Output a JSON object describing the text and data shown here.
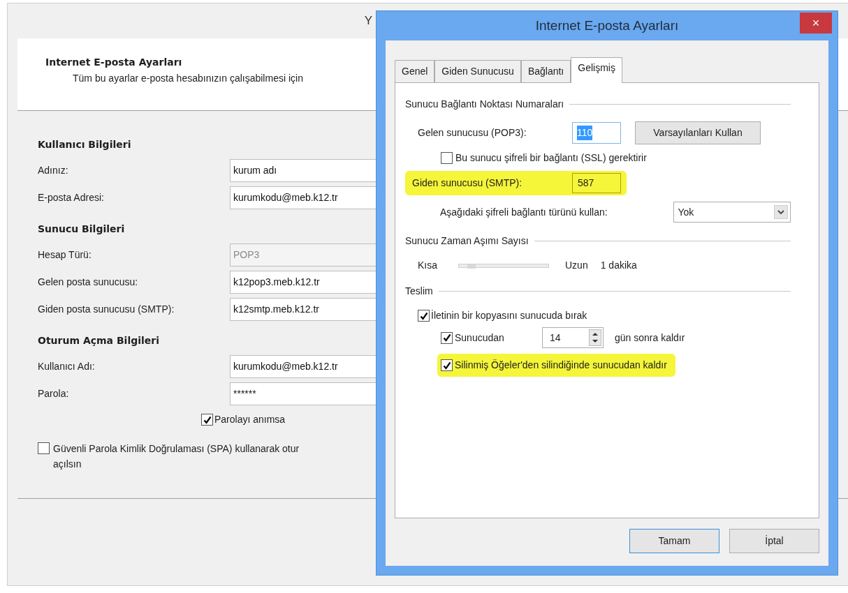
{
  "background_window": {
    "title": "Y",
    "header": {
      "title": "Internet E-posta Ayarları",
      "subtitle": "Tüm bu ayarlar e-posta hesabınızın çalışabilmesi için"
    },
    "sections": [
      {
        "heading": "Kullanıcı Bilgileri",
        "fields": [
          {
            "label": "Adınız:",
            "value": "kurum adı",
            "disabled": false
          },
          {
            "label": "E-posta Adresi:",
            "value": "kurumkodu@meb.k12.tr",
            "disabled": false
          }
        ]
      },
      {
        "heading": "Sunucu Bilgileri",
        "fields": [
          {
            "label": "Hesap Türü:",
            "value": "POP3",
            "disabled": true
          },
          {
            "label": "Gelen posta sunucusu:",
            "value": "k12pop3.meb.k12.tr",
            "disabled": false
          },
          {
            "label": "Giden posta sunucusu (SMTP):",
            "value": "k12smtp.meb.k12.tr",
            "disabled": false
          }
        ]
      },
      {
        "heading": "Oturum Açma Bilgileri",
        "fields": [
          {
            "label": "Kullanıcı Adı:",
            "value": "kurumkodu@meb.k12.tr",
            "disabled": false
          },
          {
            "label": "Parola:",
            "value": "******",
            "disabled": false
          }
        ]
      }
    ],
    "remember_password": {
      "label": "Parolayı anımsa",
      "checked": true
    },
    "spa": {
      "lines": [
        "Güvenli Parola Kimlik Doğrulaması (SPA) kullanarak otur",
        "açılsın"
      ],
      "checked": false
    }
  },
  "dialog": {
    "title": "Internet E-posta Ayarları",
    "close": "×",
    "tabs": [
      {
        "label": "Genel",
        "selected": false
      },
      {
        "label": "Giden Sunucusu",
        "selected": false
      },
      {
        "label": "Bağlantı",
        "selected": false
      },
      {
        "label": "Gelişmiş",
        "selected": true
      }
    ],
    "port_group": {
      "heading": "Sunucu Bağlantı Noktası Numaraları",
      "incoming": {
        "label": "Gelen sunucusu (POP3):",
        "value": "110",
        "selected": true
      },
      "defaults_button": "Varsayılanları Kullan",
      "ssl": {
        "label": "Bu sunucu şifreli bir bağlantı (SSL) gerektirir",
        "checked": false
      },
      "outgoing": {
        "label": "Giden sunucusu (SMTP):",
        "value": "587",
        "highlighted": true
      },
      "encryption": {
        "label": "Aşağıdaki şifreli bağlantı türünü kullan:",
        "value": "Yok"
      }
    },
    "timeout_group": {
      "heading": "Sunucu Zaman Aşımı Sayısı",
      "min_label": "Kısa",
      "max_label": "Uzun",
      "level": 0.1,
      "reading": "1 dakika"
    },
    "delivery_group": {
      "heading": "Teslim",
      "leave_copy": {
        "label": "İletinin bir kopyasını sunucuda bırak",
        "checked": true
      },
      "remove_after": {
        "label": "Sunucudan",
        "checked": true,
        "days": "14",
        "suffix": "gün sonra kaldır"
      },
      "remove_deleted": {
        "label": "Silinmiş Öğeler'den silindiğinde sunucudan kaldır",
        "checked": true,
        "highlighted": true
      }
    },
    "buttons": [
      {
        "label": "Tamam",
        "default": true
      },
      {
        "label": "İptal",
        "default": false
      }
    ]
  }
}
